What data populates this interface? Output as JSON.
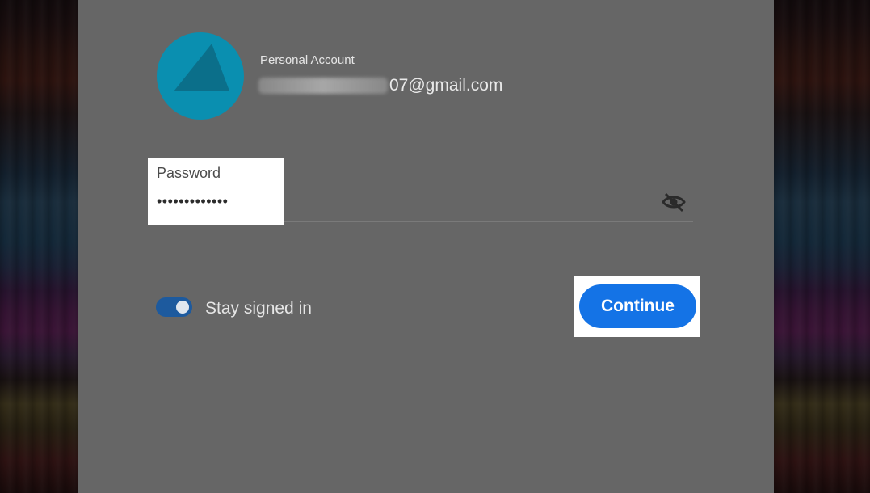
{
  "account": {
    "type_label": "Personal Account",
    "email_visible_suffix": "07@gmail.com"
  },
  "password": {
    "label": "Password",
    "masked_value": "•••••••••••••"
  },
  "icons": {
    "avatar": "adobe-avatar-icon",
    "visibility": "eye-slash-icon"
  },
  "stay_signed_in": {
    "label": "Stay signed in",
    "enabled": true
  },
  "continue_button": {
    "label": "Continue"
  },
  "colors": {
    "accent": "#1473e6",
    "toggle_on": "#1d5a9e",
    "avatar": "#0a8fb0"
  }
}
